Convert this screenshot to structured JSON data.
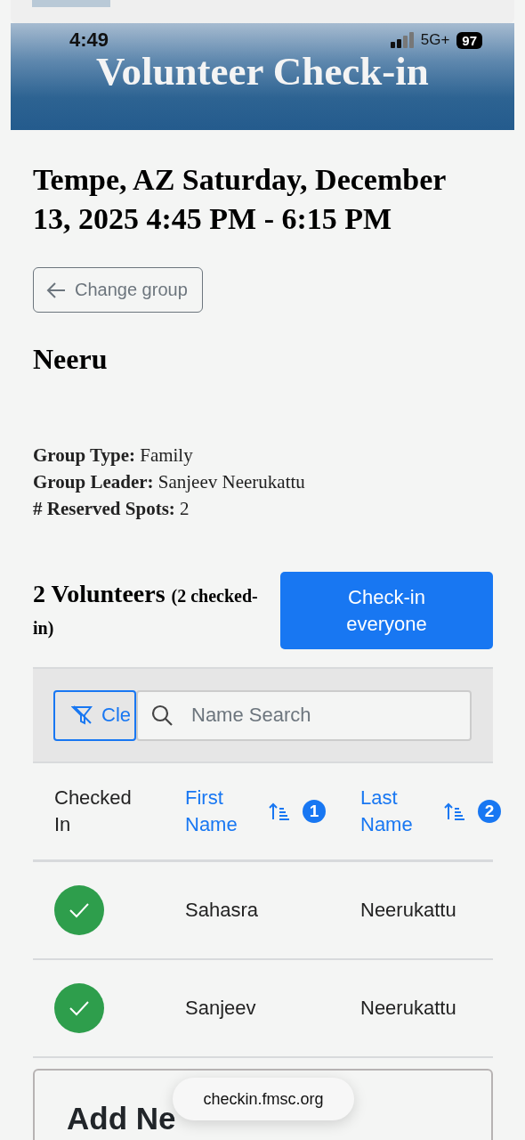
{
  "status_bar": {
    "time": "4:49",
    "network": "5G+",
    "battery": "97"
  },
  "header": {
    "title": "Volunteer Check-in"
  },
  "event": {
    "title": "Tempe, AZ Saturday, December 13, 2025 4:45 PM - 6:15 PM"
  },
  "change_group_button": {
    "label": "Change group"
  },
  "group": {
    "name": "Neeru",
    "details": [
      {
        "label": "Group Type:",
        "value": "Family"
      },
      {
        "label": "Group Leader:",
        "value": "Sanjeev Neerukattu"
      },
      {
        "label": "# Reserved Spots:",
        "value": "2"
      }
    ]
  },
  "volunteers": {
    "count": "2 Volunteers",
    "checked_note": "(2 checked-in)",
    "check_in_all_button": "Check-in everyone"
  },
  "filter": {
    "clear_button": "Cle",
    "search": {
      "placeholder": "Name Search"
    }
  },
  "table": {
    "columns": [
      {
        "label": "Checked In",
        "sortable": false
      },
      {
        "label": "First Name",
        "sortable": true,
        "sort_order": "1"
      },
      {
        "label": "Last Name",
        "sortable": true,
        "sort_order": "2"
      }
    ],
    "rows": [
      {
        "checked_in": true,
        "first_name": "Sahasra",
        "last_name": "Neerukattu"
      },
      {
        "checked_in": true,
        "first_name": "Sanjeev",
        "last_name": "Neerukattu"
      }
    ]
  },
  "add_new": {
    "title": "Add Ne"
  },
  "url_pill": {
    "text": "checkin.fmsc.org"
  }
}
